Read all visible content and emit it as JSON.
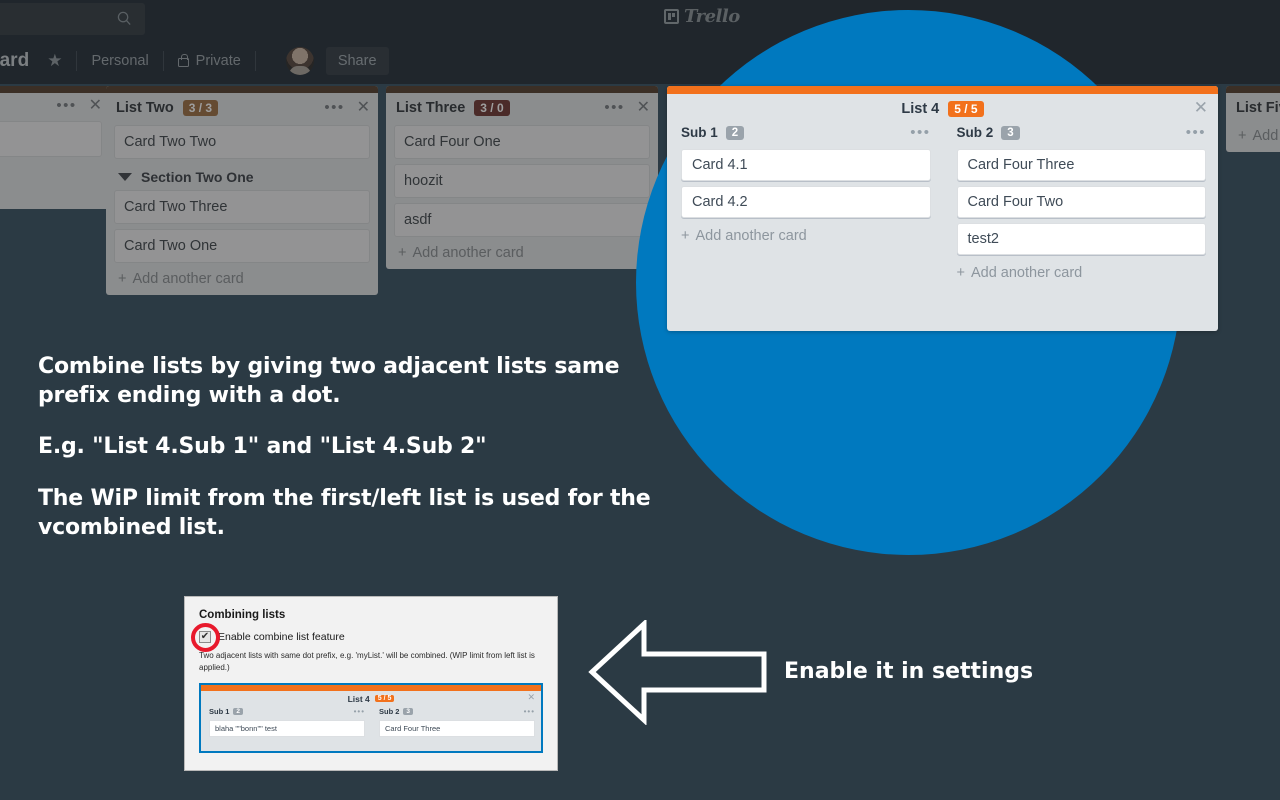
{
  "nav": {
    "search_placeholder": "",
    "search_icon": "search-icon",
    "logo_text": "Trello"
  },
  "board_bar": {
    "title": "oard",
    "star_icon": "★",
    "visibility_group": "Personal",
    "visibility": "Private",
    "lock_icon": "lock-icon",
    "share_label": "Share"
  },
  "lists": [
    {
      "name": "",
      "wip": "",
      "cards": [
        ""
      ],
      "add_label": ""
    },
    {
      "name": "List Two",
      "wip": "3 / 3",
      "wip_state": "at-limit",
      "cards": [
        "Card Two Two"
      ],
      "section": "Section Two One",
      "section_cards": [
        "Card Two Three",
        "Card Two One"
      ],
      "add_label": "Add another card"
    },
    {
      "name": "List Three",
      "wip": "3 / 0",
      "wip_state": "over-limit",
      "cards": [
        "Card Four One",
        "hoozit",
        "asdf"
      ],
      "add_label": "Add another card"
    },
    {
      "name": "List Five",
      "wip": "",
      "add_label": "Add"
    }
  ],
  "list4": {
    "title": "List 4",
    "wip": "5 / 5",
    "close_icon": "✕",
    "subs": [
      {
        "title": "Sub 1",
        "count": "2",
        "cards": [
          "Card 4.1",
          "Card 4.2"
        ],
        "add_label": "Add another card",
        "menu_icon": "•••"
      },
      {
        "title": "Sub 2",
        "count": "3",
        "cards": [
          "Card Four Three",
          "Card Four Two",
          "test2"
        ],
        "add_label": "Add another card",
        "menu_icon": "•••"
      }
    ]
  },
  "captions": {
    "line1": "Combine lists by giving two adjacent lists same prefix ending with a dot.",
    "line2": "E.g. \"List 4.Sub 1\" and \"List 4.Sub 2\"",
    "line3": "The WiP limit from the first/left list is used for the vcombined list."
  },
  "settings": {
    "heading": "Combining lists",
    "checkbox_label": "Enable combine list feature",
    "checkbox_checked": true,
    "description": "Two adjacent lists with same dot prefix, e.g. 'myList.' will be combined. (WIP limit from left list is applied.)",
    "preview": {
      "title": "List 4",
      "wip": "5 / 5",
      "close_icon": "✕",
      "subs": [
        {
          "title": "Sub 1",
          "count": "2",
          "card": "blaha \"\"bonn\"\"   test"
        },
        {
          "title": "Sub 2",
          "count": "3",
          "card": "Card Four Three"
        }
      ]
    }
  },
  "callout": {
    "arrow_icon": "left-arrow-icon",
    "label": "Enable it in settings"
  },
  "colors": {
    "board_bg": "#2b3a44",
    "spotlight_blue": "#0079bf",
    "accent_orange": "#f2711c",
    "wip_over": "#9b3d36",
    "wip_at": "#c0752a",
    "red_ring": "#e8192c"
  }
}
